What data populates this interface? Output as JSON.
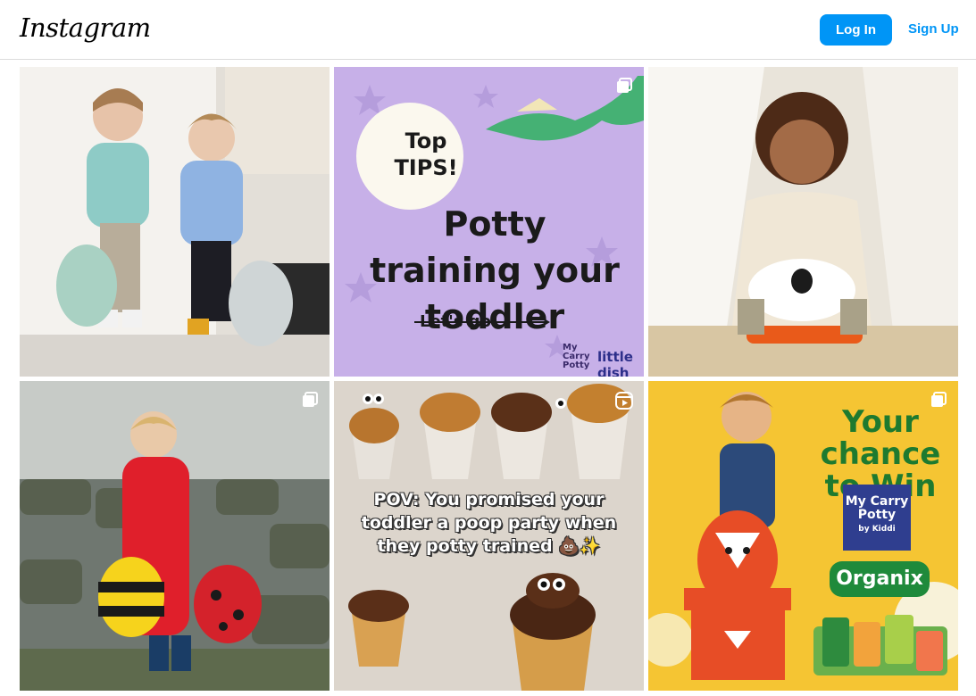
{
  "header": {
    "logo_text": "Instagram",
    "login_label": "Log In",
    "signup_label": "Sign Up",
    "accent_color": "#0095f6"
  },
  "posts": [
    {
      "type": "photo",
      "description_icon": "none"
    },
    {
      "type": "carousel",
      "badge_icon": "carousel-icon",
      "top_tips": "Top TIPS!",
      "headline": "Potty training your toddler",
      "cta": "Let's go!",
      "brand_small": "My Carry Potty",
      "brand_dish": "little dish"
    },
    {
      "type": "photo"
    },
    {
      "type": "carousel",
      "badge_icon": "carousel-icon"
    },
    {
      "type": "reel",
      "badge_icon": "reel-icon",
      "caption": "POV: You promised your toddler a poop party when they potty trained 💩✨"
    },
    {
      "type": "carousel",
      "badge_icon": "carousel-icon",
      "headline": "Your chance to Win",
      "brand_box": "My Carry Potty",
      "brand_box_sub": "by Kiddi",
      "partner": "Organix"
    }
  ]
}
